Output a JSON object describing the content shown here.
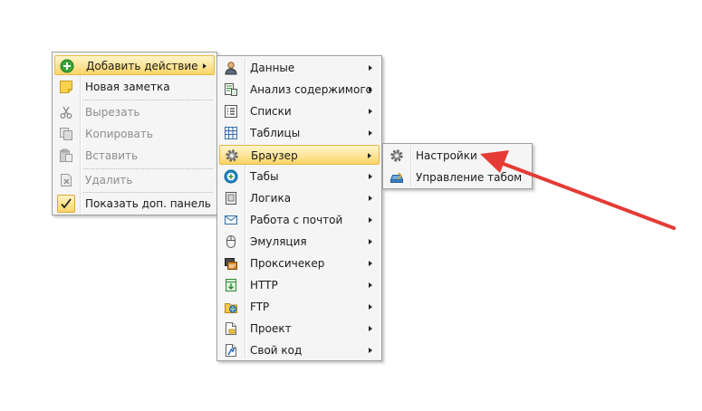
{
  "context_menu": {
    "items": [
      {
        "label": "Добавить действие",
        "icon": "add-action-icon"
      },
      {
        "label": "Новая заметка",
        "icon": "note-icon"
      },
      {
        "label": "Вырезать",
        "icon": "scissors-icon"
      },
      {
        "label": "Копировать",
        "icon": "copy-icon"
      },
      {
        "label": "Вставить",
        "icon": "paste-icon"
      },
      {
        "label": "Удалить",
        "icon": "delete-icon"
      },
      {
        "label": "Показать доп. панель",
        "icon": "checkmark-icon"
      }
    ]
  },
  "actions_submenu": {
    "items": [
      {
        "label": "Данные",
        "icon": "user-data-icon"
      },
      {
        "label": "Анализ содержимого",
        "icon": "content-analysis-icon"
      },
      {
        "label": "Списки",
        "icon": "list-icon"
      },
      {
        "label": "Таблицы",
        "icon": "table-icon"
      },
      {
        "label": "Браузер",
        "icon": "gear-icon"
      },
      {
        "label": "Табы",
        "icon": "tabs-icon"
      },
      {
        "label": "Логика",
        "icon": "logic-icon"
      },
      {
        "label": "Работа с почтой",
        "icon": "mail-icon"
      },
      {
        "label": "Эмуляция",
        "icon": "mouse-icon"
      },
      {
        "label": "Проксичекер",
        "icon": "proxy-checker-icon"
      },
      {
        "label": "HTTP",
        "icon": "http-icon"
      },
      {
        "label": "FTP",
        "icon": "ftp-icon"
      },
      {
        "label": "Проект",
        "icon": "project-icon"
      },
      {
        "label": "Свой код",
        "icon": "custom-code-icon"
      }
    ]
  },
  "browser_submenu": {
    "items": [
      {
        "label": "Настройки",
        "icon": "gear-icon"
      },
      {
        "label": "Управление табом",
        "icon": "tab-control-icon"
      }
    ]
  },
  "colors": {
    "highlight": "#fde497",
    "highlight_border": "#e5b84a",
    "arrow": "#e53b35",
    "menu_bg": "#f5f5f5"
  }
}
